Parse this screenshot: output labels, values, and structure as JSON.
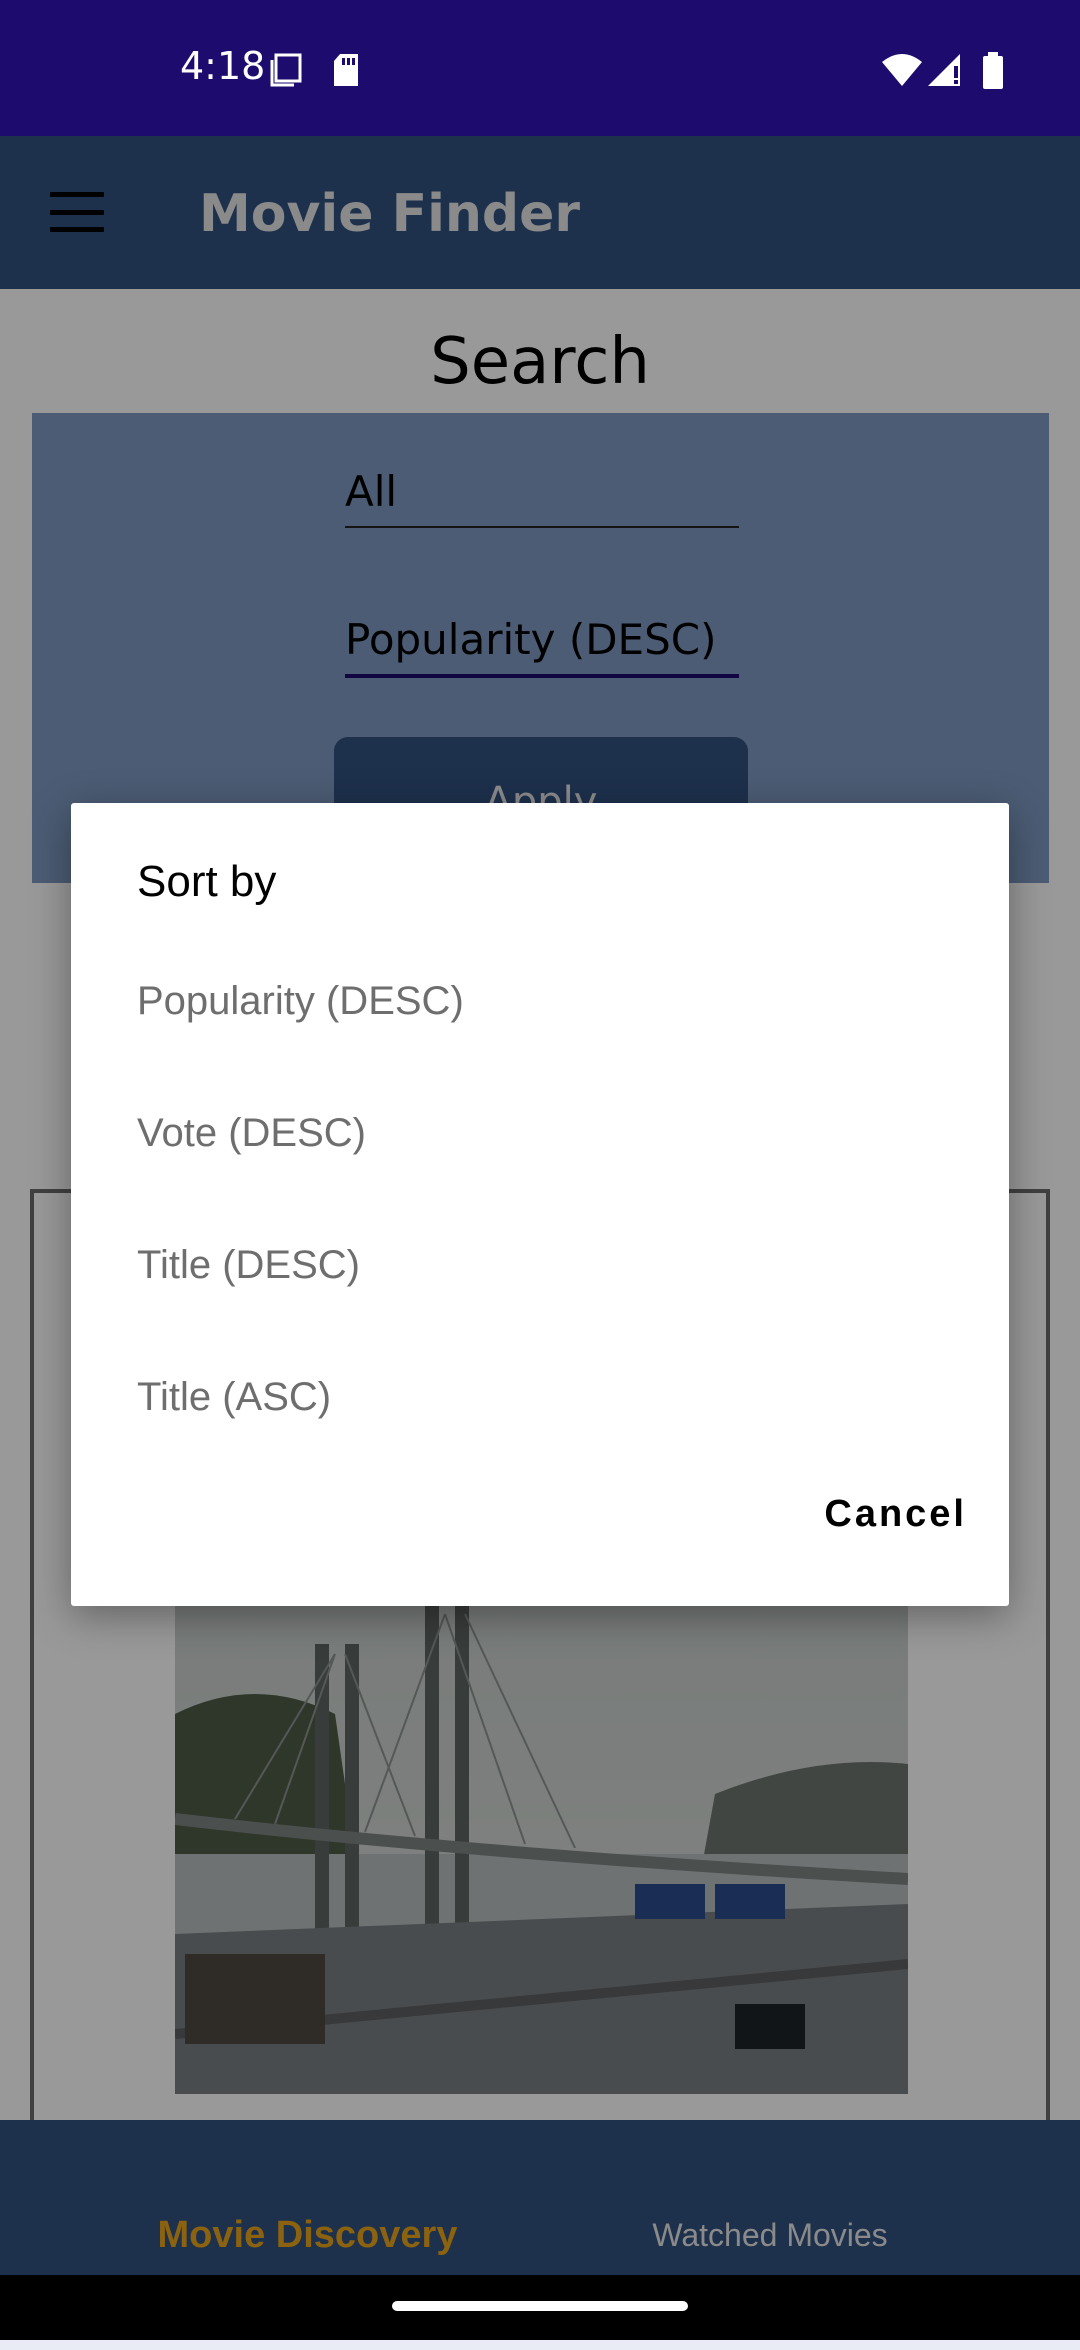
{
  "status_bar": {
    "time": "4:18",
    "icons": [
      "screenshot-icon",
      "sd-card-icon",
      "wifi-icon",
      "signal-icon",
      "battery-icon"
    ]
  },
  "app_bar": {
    "title": "Movie Finder",
    "menu_icon": "hamburger-menu-icon"
  },
  "search": {
    "heading": "Search",
    "genre_value": "All",
    "sort_value": "Popularity (DESC)",
    "apply_label": "Apply"
  },
  "bottom_nav": {
    "items": [
      {
        "label": "Movie Discovery",
        "active": true
      },
      {
        "label": "Watched Movies",
        "active": false
      }
    ]
  },
  "dialog": {
    "title": "Sort by",
    "options": [
      {
        "label": "Popularity (DESC)"
      },
      {
        "label": "Vote (DESC)"
      },
      {
        "label": "Title (DESC)"
      },
      {
        "label": "Title (ASC)"
      }
    ],
    "cancel_label": "Cancel"
  },
  "colors": {
    "status_bar": "#1e0b6e",
    "app_bar": "#31507f",
    "nav_active": "#e8a41a",
    "filter_card": "#7e99c2"
  }
}
